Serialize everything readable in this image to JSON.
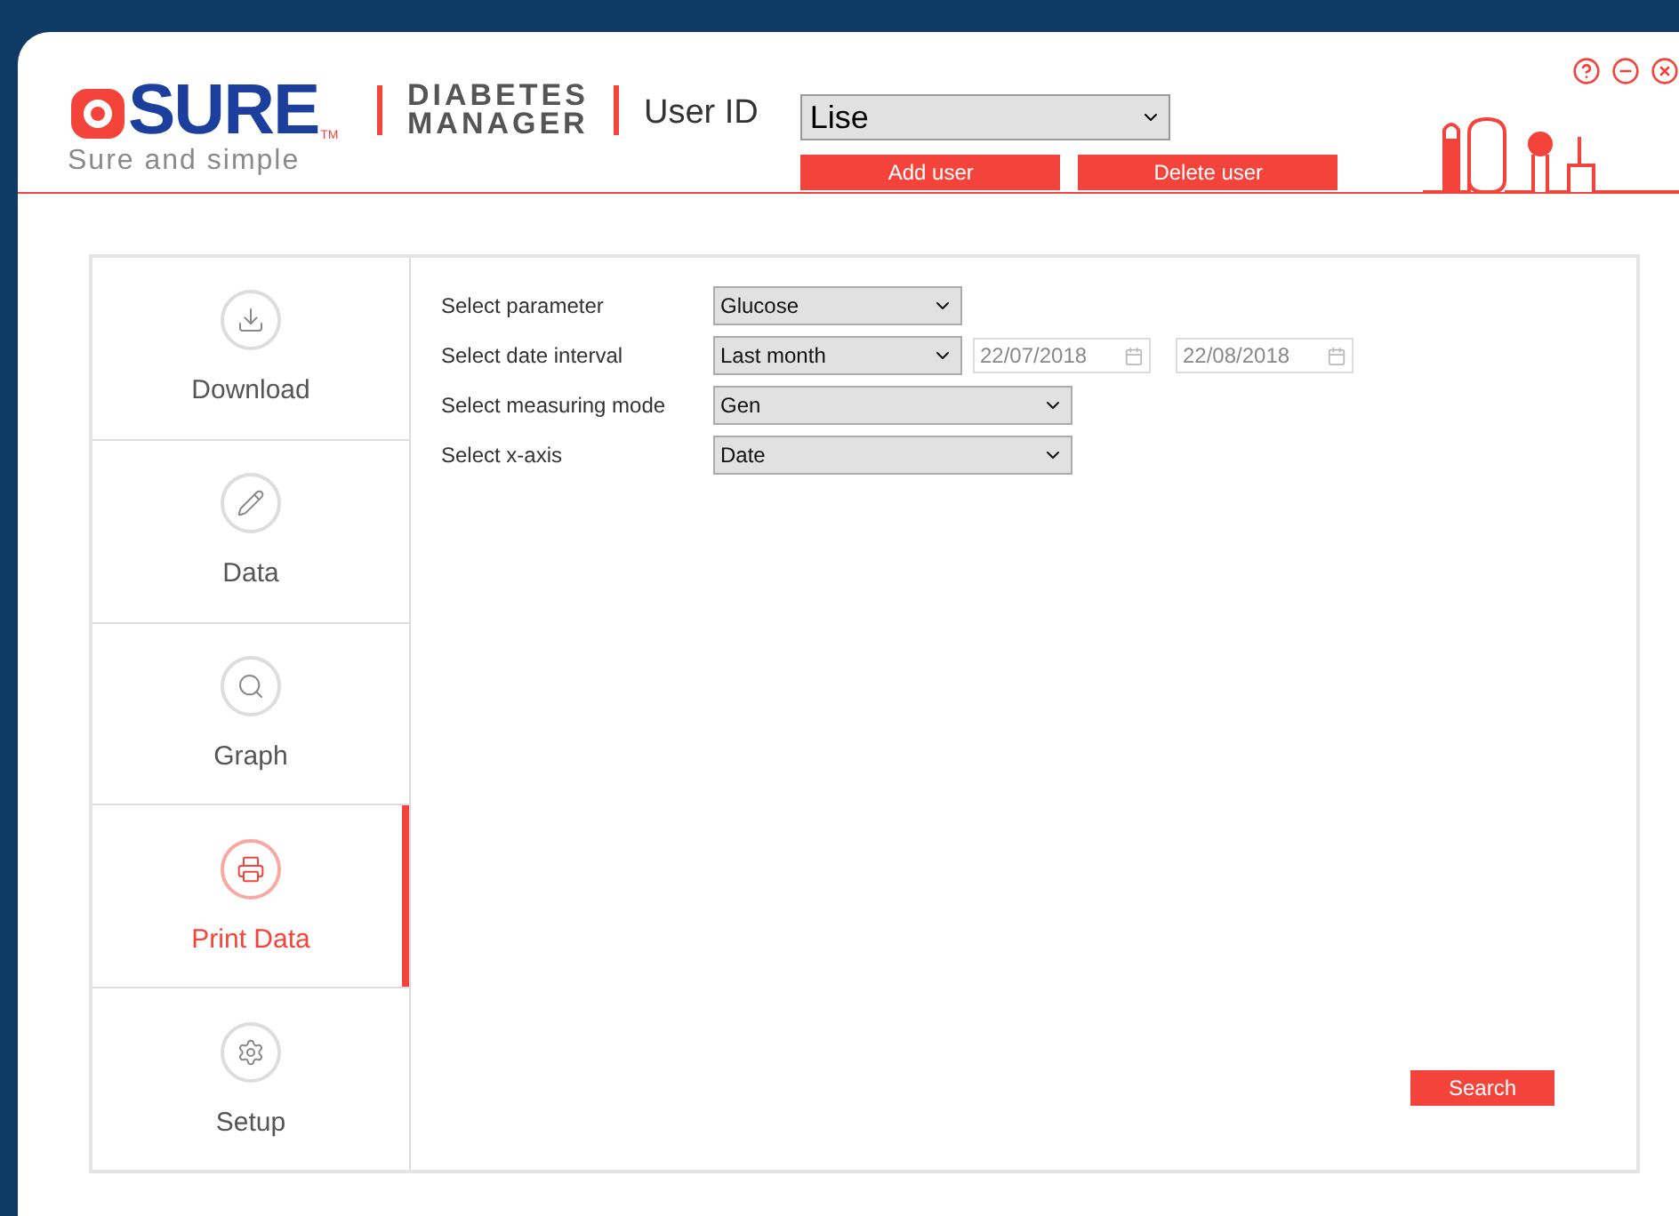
{
  "header": {
    "logo": {
      "brand": "SURE",
      "trademark": "TM",
      "tagline": "Sure and simple"
    },
    "product": [
      "DIABETES",
      "MANAGER"
    ],
    "user_label": "User ID",
    "user_select": "Lise",
    "buttons": [
      "Add user",
      "Delete user"
    ]
  },
  "sidebar": {
    "items": [
      {
        "label": "Download",
        "selected": false
      },
      {
        "label": "Data",
        "selected": false
      },
      {
        "label": "Graph",
        "selected": false
      },
      {
        "label": "Print Data",
        "selected": true
      },
      {
        "label": "Setup",
        "selected": false
      }
    ]
  },
  "form": {
    "rows": [
      {
        "label": "Select parameter",
        "value": "Glucose",
        "kind": "short",
        "dates": []
      },
      {
        "label": "Select date interval",
        "value": "Last month",
        "kind": "short",
        "dates": [
          {
            "value": "22/07/2018",
            "disabled": true
          },
          {
            "value": "22/08/2018",
            "disabled": true
          }
        ]
      },
      {
        "label": "Select measuring mode",
        "value": "Gen",
        "kind": "long",
        "dates": []
      },
      {
        "label": "Select x-axis",
        "value": "Date",
        "kind": "long",
        "dates": []
      }
    ]
  },
  "search_button": "Search"
}
